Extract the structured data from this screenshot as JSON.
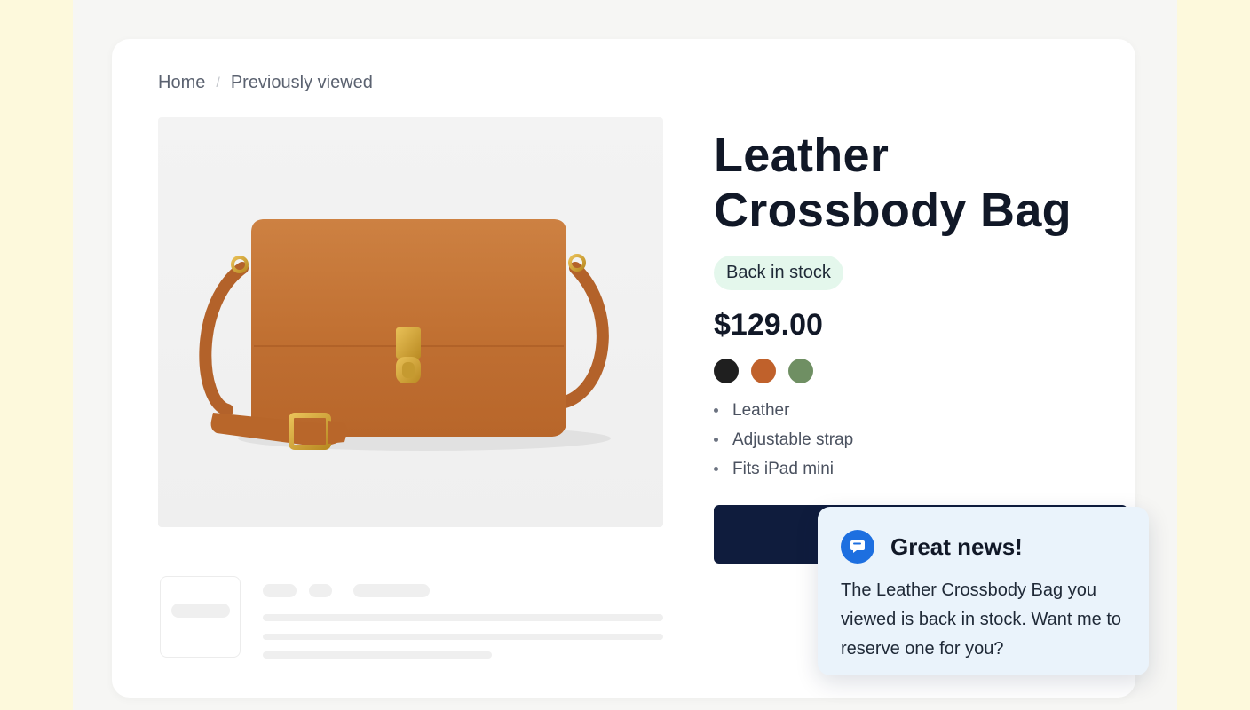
{
  "breadcrumb": {
    "home": "Home",
    "separator": "/",
    "current": "Previously viewed"
  },
  "product": {
    "image": {
      "alt": "handbag-image",
      "icon": "bag-illustration"
    },
    "title_line1": "Leather",
    "title_line2": "Crossbody Bag",
    "badge": "Back in stock",
    "price": "$129.00",
    "swatches": [
      {
        "name": "black",
        "color": "#1f1f1f"
      },
      {
        "name": "tan",
        "color": "#c0612b"
      },
      {
        "name": "sage",
        "color": "#6f8f63"
      }
    ],
    "features": [
      "Leather",
      "Adjustable strap",
      "Fits iPad mini"
    ]
  },
  "colors": {
    "cta": "#0f1c3d",
    "badge_bg": "#e4f7ec",
    "toast_bg": "#eaf3fb",
    "toast_icon": "#1d6fe0"
  },
  "notification": {
    "icon": "chat-bubble-icon",
    "title": "Great news!",
    "body": "The Leather Crossbody Bag you viewed is back in stock. Want me to reserve one for you?"
  }
}
